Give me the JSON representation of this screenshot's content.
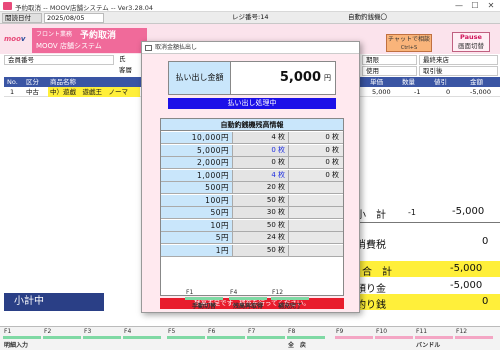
{
  "window": {
    "title": "予約取消 -- MOOV店舗システム -- Ver3.28.04",
    "minimize": "—",
    "maximize": "☐",
    "close": "✕"
  },
  "infobar": {
    "date_label": "閲読日付",
    "date_value": "2025/08/05",
    "register_label": "レジ番号:14",
    "machine_label": "自動釣銭機〇"
  },
  "brand": {
    "logo_a": "moo",
    "logo_b": "v",
    "dept": "フロント業務",
    "screen": "予約取消",
    "system": "MOOV 店舗システム"
  },
  "chat_button": {
    "label": "チャットで相談",
    "key": "Ctrl+S"
  },
  "pause_button": {
    "line1": "Pause",
    "line2": "画面切替"
  },
  "customer": {
    "member_label": "会員番号",
    "name_label": "氏",
    "guest_label": "客層",
    "right1": "期限",
    "right2": "最終来店",
    "right3": "使用",
    "right4": "取引後"
  },
  "grid": {
    "headers": [
      "No.",
      "区分",
      "商品名称",
      "単価",
      "数量",
      "値引",
      "金額"
    ],
    "row": {
      "no": "1",
      "kubun": "中古",
      "name": "中）遊戯　遊戯王　ノーマ",
      "price": "5,000",
      "qty": "-1",
      "disc": "0",
      "amount": "-5,000"
    }
  },
  "summary": {
    "subtotal_label": "小　計",
    "subtotal_qty": "-1",
    "subtotal_value": "-5,000",
    "tax_label": "消費税",
    "tax_value": "0",
    "total_label": "合　計",
    "total_value": "-5,000",
    "deposit_label": "預り金",
    "deposit_value": "-5,000",
    "change_label": "釣り銭",
    "change_value": "0"
  },
  "status_label": "小計中",
  "fkeys": [
    {
      "num": "F1",
      "label": "明細入力",
      "color": "#7fd9a4"
    },
    {
      "num": "F2",
      "label": "",
      "color": "#7fd9a4"
    },
    {
      "num": "F3",
      "label": "",
      "color": "#7fd9a4"
    },
    {
      "num": "F4",
      "label": "",
      "color": "#7fd9a4"
    },
    {
      "num": "F5",
      "label": "",
      "color": "#7fd9a4"
    },
    {
      "num": "F6",
      "label": "",
      "color": "#7fd9a4"
    },
    {
      "num": "F7",
      "label": "",
      "color": "#7fd9a4"
    },
    {
      "num": "F8",
      "label": "全　戻",
      "color": "#7fd9a4"
    },
    {
      "num": "F9",
      "label": "",
      "color": "#f4a6c4"
    },
    {
      "num": "F10",
      "label": "",
      "color": "#f4a6c4"
    },
    {
      "num": "F11",
      "label": "バンドル",
      "color": "#f4a6c4"
    },
    {
      "num": "F12",
      "label": "",
      "color": "#f4a6c4"
    }
  ],
  "dialog": {
    "title": "取消金額払出し",
    "amount_label": "払い出し金額",
    "amount_value": "5,000",
    "amount_unit": "円",
    "processing": "払い出し処理中",
    "cash_header": "自動釣銭機残高情報",
    "denoms": [
      {
        "label": "10,000円",
        "count": "4 枚",
        "stock": "0 枚",
        "count_blue": false
      },
      {
        "label": "5,000円",
        "count": "0 枚",
        "stock": "0 枚",
        "count_blue": true
      },
      {
        "label": "2,000円",
        "count": "0 枚",
        "stock": "0 枚",
        "count_blue": false
      },
      {
        "label": "1,000円",
        "count": "4 枚",
        "stock": "0 枚",
        "count_blue": true
      },
      {
        "label": "500円",
        "count": "20 枚",
        "stock": "",
        "count_blue": false
      },
      {
        "label": "100円",
        "count": "50 枚",
        "stock": "",
        "count_blue": false
      },
      {
        "label": "50円",
        "count": "30 枚",
        "stock": "",
        "count_blue": false
      },
      {
        "label": "10円",
        "count": "50 枚",
        "stock": "",
        "count_blue": false
      },
      {
        "label": "5円",
        "count": "24 枚",
        "stock": "",
        "count_blue": false
      },
      {
        "label": "1円",
        "count": "50 枚",
        "stock": "",
        "count_blue": false
      }
    ],
    "warning": "残高不足です。補充を行ってください。",
    "fkeys": [
      {
        "num": "F1",
        "label": "手動切替"
      },
      {
        "num": "F4",
        "label": "残高再取得"
      },
      {
        "num": "F12",
        "label": "補充完了"
      }
    ]
  }
}
